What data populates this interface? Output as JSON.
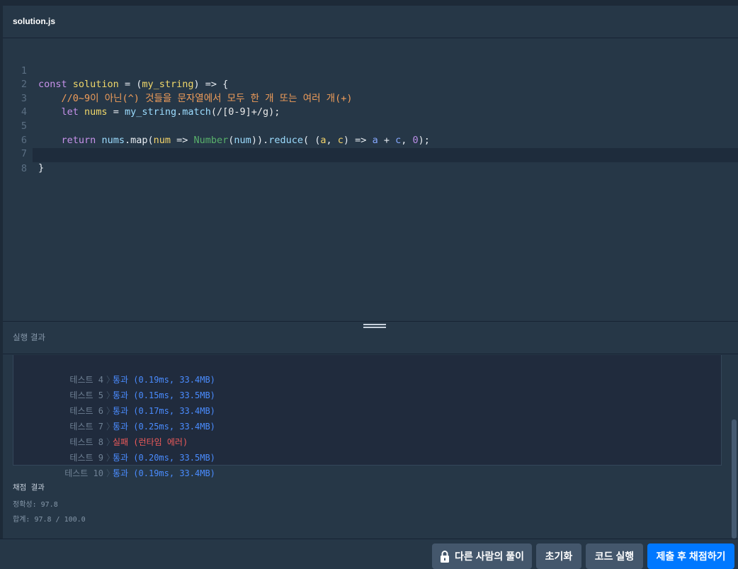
{
  "editor": {
    "file_name": "solution.js",
    "lines": [
      {
        "n": "1"
      },
      {
        "n": "2"
      },
      {
        "n": "3"
      },
      {
        "n": "4"
      },
      {
        "n": "5"
      },
      {
        "n": "6"
      },
      {
        "n": "7"
      },
      {
        "n": "8"
      }
    ],
    "code": {
      "l1_kw": "const",
      "l1_name": "solution",
      "l1_eq": " = (",
      "l1_arg": "my_string",
      "l1_end": ") => {",
      "l2": "//0~9이 아닌(^) 것들을 문자열에서 모두 한 개 또는 여러 개(+)",
      "l3_kw": "let",
      "l3_var": "nums",
      "l3_eq": " = ",
      "l3_obj": "my_string",
      "l3_dot": ".",
      "l3_fn": "match",
      "l3_rest": "(/[0-9]+/g);",
      "l5_kw": "return",
      "l5_var": "nums",
      "l5_map": ".map(",
      "l5_num": "num",
      "l5_arrow": " => ",
      "l5_ctor": "Number",
      "l5_p1": "(",
      "l5_num2": "num",
      "l5_p2": ")).",
      "l5_reduce": "reduce",
      "l5_p3": "( (",
      "l5_a": "a",
      "l5_comma": ", ",
      "l5_c": "c",
      "l5_arrow2": ") => ",
      "l5_a2": "a",
      "l5_plus": " + ",
      "l5_c2": "c",
      "l5_comma2": ", ",
      "l5_zero": "0",
      "l5_end": ");",
      "l7": "}"
    }
  },
  "results": {
    "title": "실행 결과",
    "rows": [
      {
        "label": "테스트 4",
        "sep": "〉",
        "value": "통과 (0.19ms, 33.4MB)",
        "status": "pass"
      },
      {
        "label": "테스트 5",
        "sep": "〉",
        "value": "통과 (0.15ms, 33.5MB)",
        "status": "pass"
      },
      {
        "label": "테스트 6",
        "sep": "〉",
        "value": "통과 (0.17ms, 33.4MB)",
        "status": "pass"
      },
      {
        "label": "테스트 7",
        "sep": "〉",
        "value": "통과 (0.25ms, 33.4MB)",
        "status": "pass"
      },
      {
        "label": "테스트 8",
        "sep": "〉",
        "value": "실패 (런타임 에러)",
        "status": "fail"
      },
      {
        "label": "테스트 9",
        "sep": "〉",
        "value": "통과 (0.20ms, 33.5MB)",
        "status": "pass"
      },
      {
        "label": "테스트 10",
        "sep": "〉",
        "value": "통과 (0.19ms, 33.4MB)",
        "status": "pass"
      }
    ],
    "grading_title": "채점 결과",
    "accuracy": "정확성: 97.8",
    "total": "합계: 97.8 / 100.0"
  },
  "footer": {
    "others_solution": "다른 사람의 풀이",
    "reset": "초기화",
    "run_code": "코드 실행",
    "submit": "제출 후 채점하기"
  },
  "colors": {
    "background": "#263747",
    "pass": "#4a8cff",
    "fail": "#f05b5b",
    "primary_button": "#0078ff"
  },
  "icons": [
    "lock-icon",
    "drag-handle-icon"
  ]
}
